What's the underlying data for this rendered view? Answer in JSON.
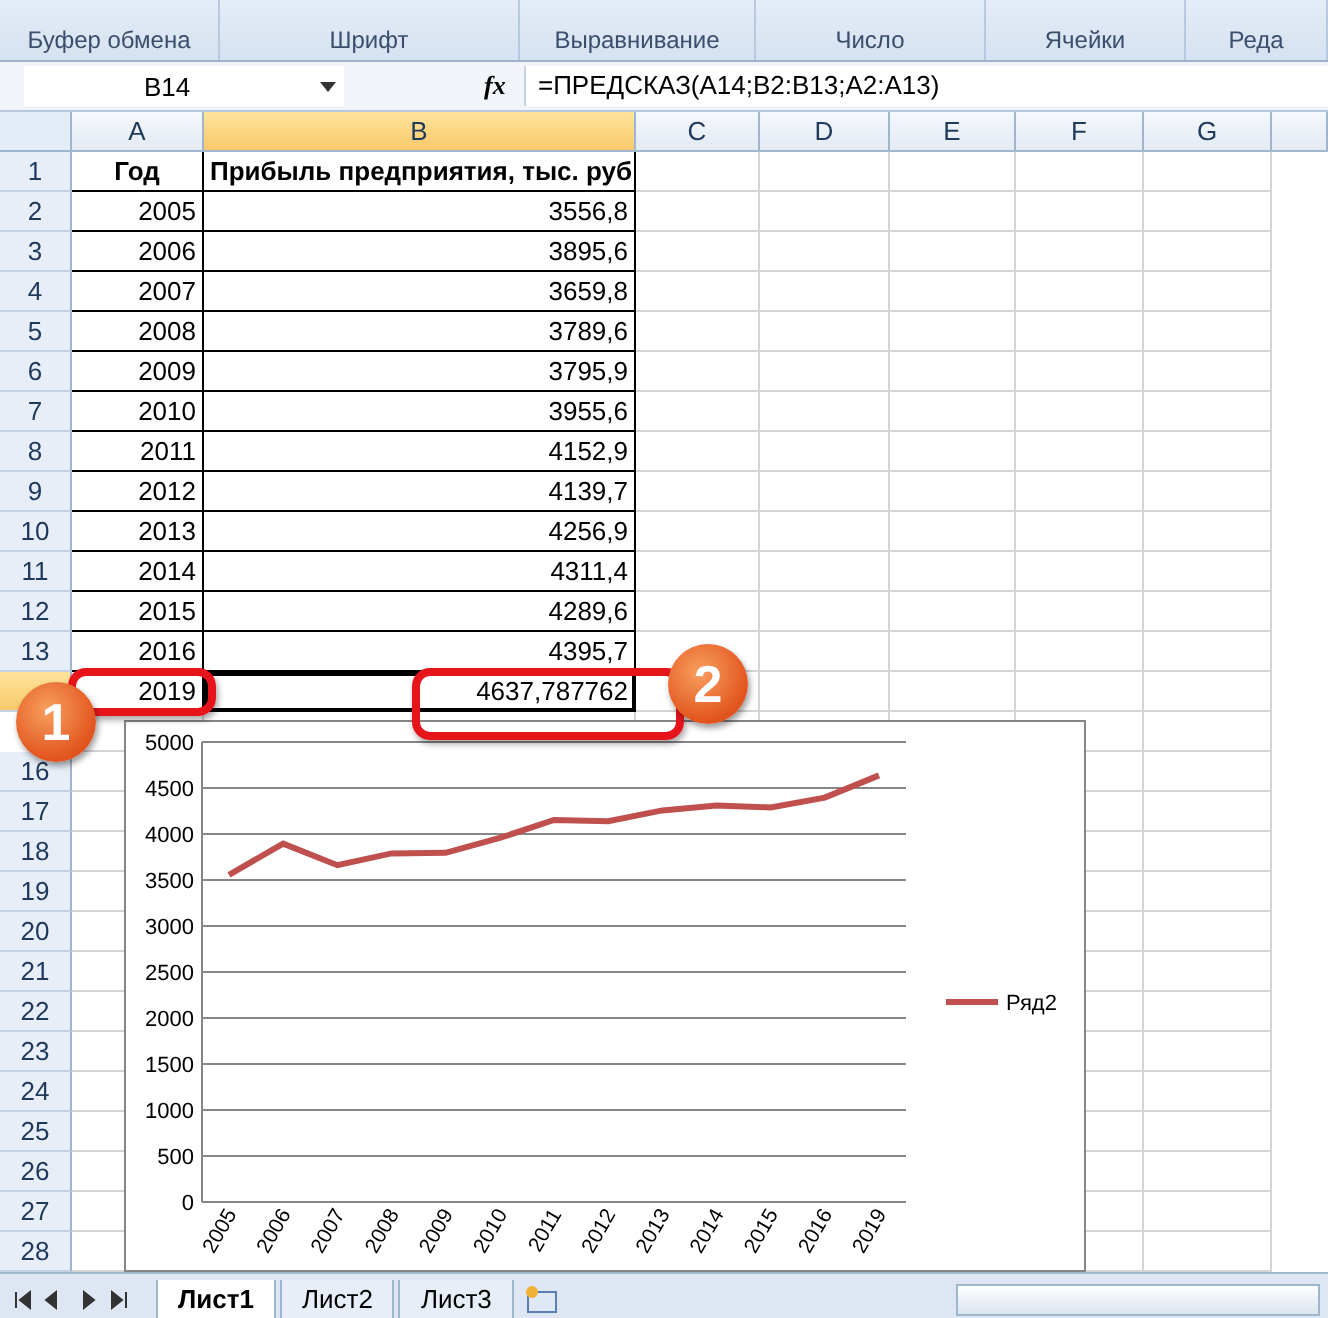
{
  "ribbon": {
    "groups": [
      "Буфер обмена",
      "Шрифт",
      "Выравнивание",
      "Число",
      "Ячейки",
      "Реда"
    ]
  },
  "formula_bar": {
    "name_box": "B14",
    "fx_label": "fx",
    "formula": "=ПРЕДСКАЗ(A14;B2:B13;A2:A13)"
  },
  "columns": [
    {
      "label": "A",
      "selected": false
    },
    {
      "label": "B",
      "selected": true
    },
    {
      "label": "C",
      "selected": false
    },
    {
      "label": "D",
      "selected": false
    },
    {
      "label": "E",
      "selected": false
    },
    {
      "label": "F",
      "selected": false
    },
    {
      "label": "G",
      "selected": false
    }
  ],
  "rows": [
    {
      "number": "1",
      "kind": "header",
      "selected": false,
      "cells": [
        "Год",
        "Прибыль предприятия, тыс. руб"
      ]
    },
    {
      "number": "2",
      "kind": "data",
      "selected": false,
      "cells": [
        "2005",
        "3556,8"
      ]
    },
    {
      "number": "3",
      "kind": "data",
      "selected": false,
      "cells": [
        "2006",
        "3895,6"
      ]
    },
    {
      "number": "4",
      "kind": "data",
      "selected": false,
      "cells": [
        "2007",
        "3659,8"
      ]
    },
    {
      "number": "5",
      "kind": "data",
      "selected": false,
      "cells": [
        "2008",
        "3789,6"
      ]
    },
    {
      "number": "6",
      "kind": "data",
      "selected": false,
      "cells": [
        "2009",
        "3795,9"
      ]
    },
    {
      "number": "7",
      "kind": "data",
      "selected": false,
      "cells": [
        "2010",
        "3955,6"
      ]
    },
    {
      "number": "8",
      "kind": "data",
      "selected": false,
      "cells": [
        "2011",
        "4152,9"
      ]
    },
    {
      "number": "9",
      "kind": "data",
      "selected": false,
      "cells": [
        "2012",
        "4139,7"
      ]
    },
    {
      "number": "10",
      "kind": "data",
      "selected": false,
      "cells": [
        "2013",
        "4256,9"
      ]
    },
    {
      "number": "11",
      "kind": "data",
      "selected": false,
      "cells": [
        "2014",
        "4311,4"
      ]
    },
    {
      "number": "12",
      "kind": "data",
      "selected": false,
      "cells": [
        "2015",
        "4289,6"
      ]
    },
    {
      "number": "13",
      "kind": "data",
      "selected": false,
      "cells": [
        "2016",
        "4395,7"
      ]
    },
    {
      "kind": "data",
      "selected": true,
      "cells": [
        "2019",
        "4637,787762"
      ]
    },
    {
      "kind": "empty",
      "selected": false
    },
    {
      "number": "16",
      "kind": "empty",
      "selected": false
    },
    {
      "number": "17",
      "kind": "empty",
      "selected": false
    },
    {
      "number": "18",
      "kind": "empty",
      "selected": false
    },
    {
      "number": "19",
      "kind": "empty",
      "selected": false
    },
    {
      "number": "20",
      "kind": "empty",
      "selected": false
    },
    {
      "number": "21",
      "kind": "empty",
      "selected": false
    },
    {
      "number": "22",
      "kind": "empty",
      "selected": false
    },
    {
      "number": "23",
      "kind": "empty",
      "selected": false
    },
    {
      "number": "24",
      "kind": "empty",
      "selected": false
    },
    {
      "number": "25",
      "kind": "empty",
      "selected": false
    },
    {
      "number": "26",
      "kind": "empty",
      "selected": false
    },
    {
      "number": "27",
      "kind": "empty",
      "selected": false
    },
    {
      "number": "28",
      "kind": "empty",
      "selected": false
    }
  ],
  "callouts": [
    "1",
    "2"
  ],
  "chart": {
    "chart_data": {
      "type": "line",
      "categories": [
        "2005",
        "2006",
        "2007",
        "2008",
        "2009",
        "2010",
        "2011",
        "2012",
        "2013",
        "2014",
        "2015",
        "2016",
        "2019"
      ],
      "series": [
        {
          "name": "Ряд2",
          "color": "#c0504d",
          "values": [
            3556.8,
            3895.6,
            3659.8,
            3789.6,
            3795.9,
            3955.6,
            4152.9,
            4139.7,
            4256.9,
            4311.4,
            4289.6,
            4395.7,
            4637.8
          ]
        }
      ],
      "grid": true,
      "ylim": [
        0,
        5000
      ],
      "yticks": [
        0,
        500,
        1000,
        1500,
        2000,
        2500,
        3000,
        3500,
        4000,
        4500,
        5000
      ]
    }
  },
  "sheet_tabs": [
    {
      "label": "Лист1",
      "selected": true
    },
    {
      "label": "Лист2",
      "selected": false
    },
    {
      "label": "Лист3",
      "selected": false
    }
  ]
}
